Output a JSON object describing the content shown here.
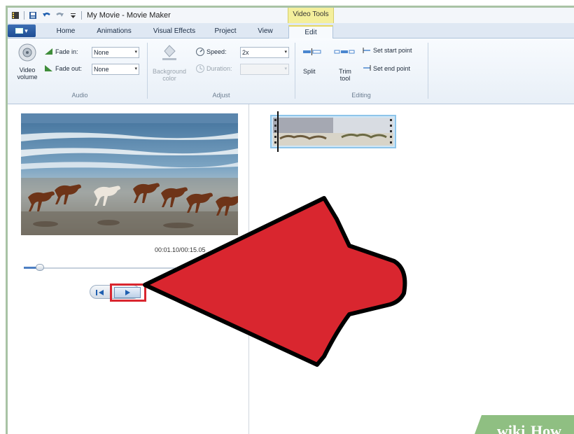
{
  "window": {
    "title": "My Movie - Movie Maker",
    "context_tab": "Video Tools"
  },
  "tabs": [
    {
      "label": "Home"
    },
    {
      "label": "Animations"
    },
    {
      "label": "Visual Effects"
    },
    {
      "label": "Project"
    },
    {
      "label": "View"
    },
    {
      "label": "Edit"
    }
  ],
  "ribbon": {
    "audio": {
      "group_label": "Audio",
      "video_volume_label": "Video volume",
      "fade_in_label": "Fade in:",
      "fade_in_value": "None",
      "fade_out_label": "Fade out:",
      "fade_out_value": "None"
    },
    "adjust": {
      "group_label": "Adjust",
      "background_color_label": "Background color",
      "speed_label": "Speed:",
      "speed_value": "2x",
      "duration_label": "Duration:",
      "duration_value": ""
    },
    "editing": {
      "group_label": "Editing",
      "split_label": "Split",
      "trim_tool_label": "Trim tool",
      "set_start_label": "Set start point",
      "set_end_label": "Set end point"
    }
  },
  "player": {
    "timecode": "00:01.10/00:15.05",
    "seek_position": 0.09
  },
  "watermark": {
    "wiki": "wiki",
    "how": "How"
  },
  "colors": {
    "annotation_red": "#d9262f",
    "accent_blue": "#1f5fb0",
    "context_yellow": "#f4ef9c"
  }
}
